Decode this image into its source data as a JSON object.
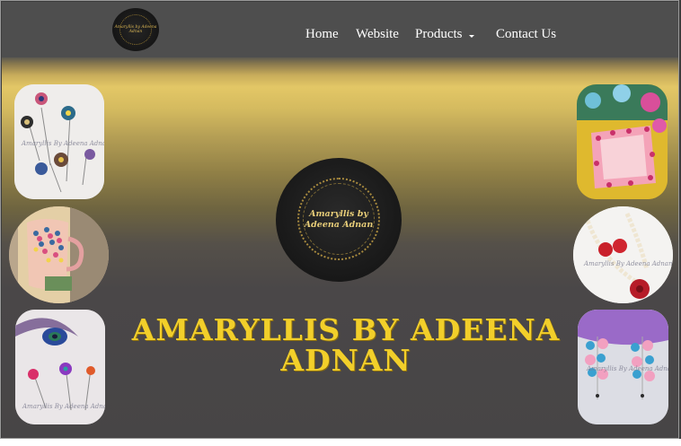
{
  "header": {
    "logo_text": "Amaryllis by Adeena Adnan",
    "nav": [
      {
        "label": "Home"
      },
      {
        "label": "Website"
      },
      {
        "label": "Products"
      },
      {
        "label": "Contact Us"
      }
    ]
  },
  "hero": {
    "center_logo_line1": "Amaryllis by",
    "center_logo_line2": "Adeena Adnan",
    "title_line1": "AMARYLLIS BY ADEENA",
    "title_line2": "ADNAN"
  },
  "gallery": {
    "watermark": "Amaryllis By Adeena Adnan"
  },
  "colors": {
    "title": "#f2cf2a",
    "navbar": "#4e4e4e",
    "gold_band": "#e3c766"
  }
}
